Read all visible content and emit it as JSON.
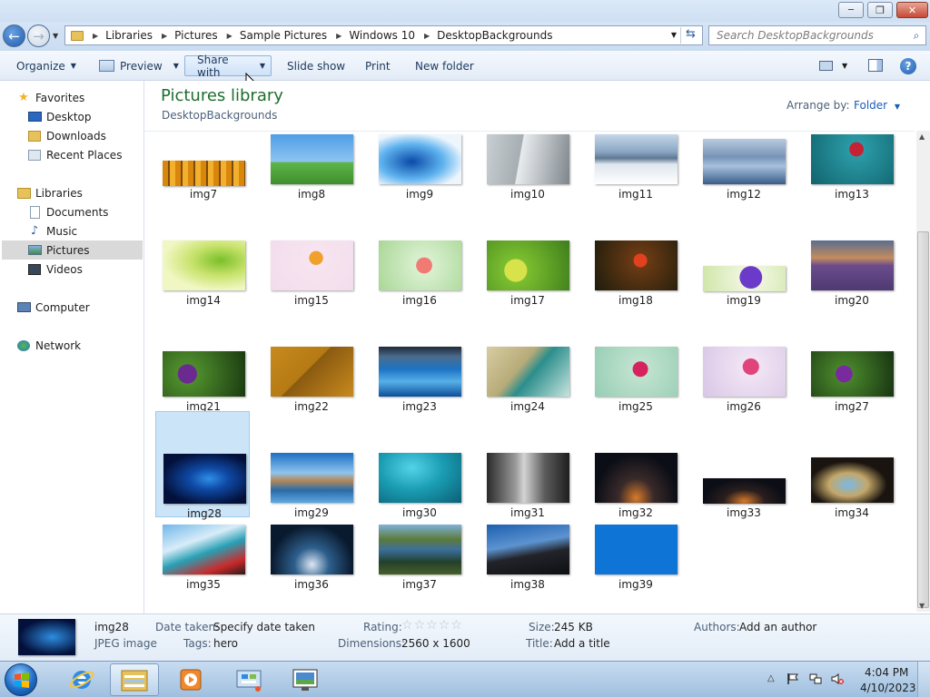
{
  "window": {
    "minimize_glyph": "─",
    "maximize_glyph": "❐",
    "close_glyph": "✕"
  },
  "address": {
    "crumbs": [
      "Libraries",
      "Pictures",
      "Sample Pictures",
      "Windows 10",
      "DesktopBackgrounds"
    ],
    "search_placeholder": "Search DesktopBackgrounds"
  },
  "toolbar": {
    "organize": "Organize",
    "preview": "Preview",
    "share_with": "Share with",
    "slide_show": "Slide show",
    "print": "Print",
    "new_folder": "New folder"
  },
  "nav": {
    "favorites": "Favorites",
    "desktop": "Desktop",
    "downloads": "Downloads",
    "recent_places": "Recent Places",
    "libraries": "Libraries",
    "documents": "Documents",
    "music": "Music",
    "pictures": "Pictures",
    "videos": "Videos",
    "computer": "Computer",
    "network": "Network"
  },
  "library": {
    "title": "Pictures library",
    "subtitle": "DesktopBackgrounds",
    "arrange_label": "Arrange by:",
    "arrange_value": "Folder"
  },
  "images": [
    {
      "name": "img7"
    },
    {
      "name": "img8"
    },
    {
      "name": "img9"
    },
    {
      "name": "img10"
    },
    {
      "name": "img11"
    },
    {
      "name": "img12"
    },
    {
      "name": "img13"
    },
    {
      "name": "img14"
    },
    {
      "name": "img15"
    },
    {
      "name": "img16"
    },
    {
      "name": "img17"
    },
    {
      "name": "img18"
    },
    {
      "name": "img19"
    },
    {
      "name": "img20"
    },
    {
      "name": "img21"
    },
    {
      "name": "img22"
    },
    {
      "name": "img23"
    },
    {
      "name": "img24"
    },
    {
      "name": "img25"
    },
    {
      "name": "img26"
    },
    {
      "name": "img27"
    },
    {
      "name": "img28"
    },
    {
      "name": "img29"
    },
    {
      "name": "img30"
    },
    {
      "name": "img31"
    },
    {
      "name": "img32"
    },
    {
      "name": "img33"
    },
    {
      "name": "img34"
    },
    {
      "name": "img35"
    },
    {
      "name": "img36"
    },
    {
      "name": "img37"
    },
    {
      "name": "img38"
    },
    {
      "name": "img39"
    }
  ],
  "selected_image": "img28",
  "details": {
    "name": "img28",
    "type": "JPEG image",
    "date_taken_label": "Date taken:",
    "date_taken_value": "Specify date taken",
    "tags_label": "Tags:",
    "tags_value": "hero",
    "rating_label": "Rating:",
    "rating_value": 0,
    "rating_max": 5,
    "dimensions_label": "Dimensions:",
    "dimensions_value": "2560 x 1600",
    "size_label": "Size:",
    "size_value": "245 KB",
    "title_label": "Title:",
    "title_value": "Add a title",
    "authors_label": "Authors:",
    "authors_value": "Add an author"
  },
  "taskbar": {
    "time": "4:04 PM",
    "date": "4/10/2023"
  }
}
